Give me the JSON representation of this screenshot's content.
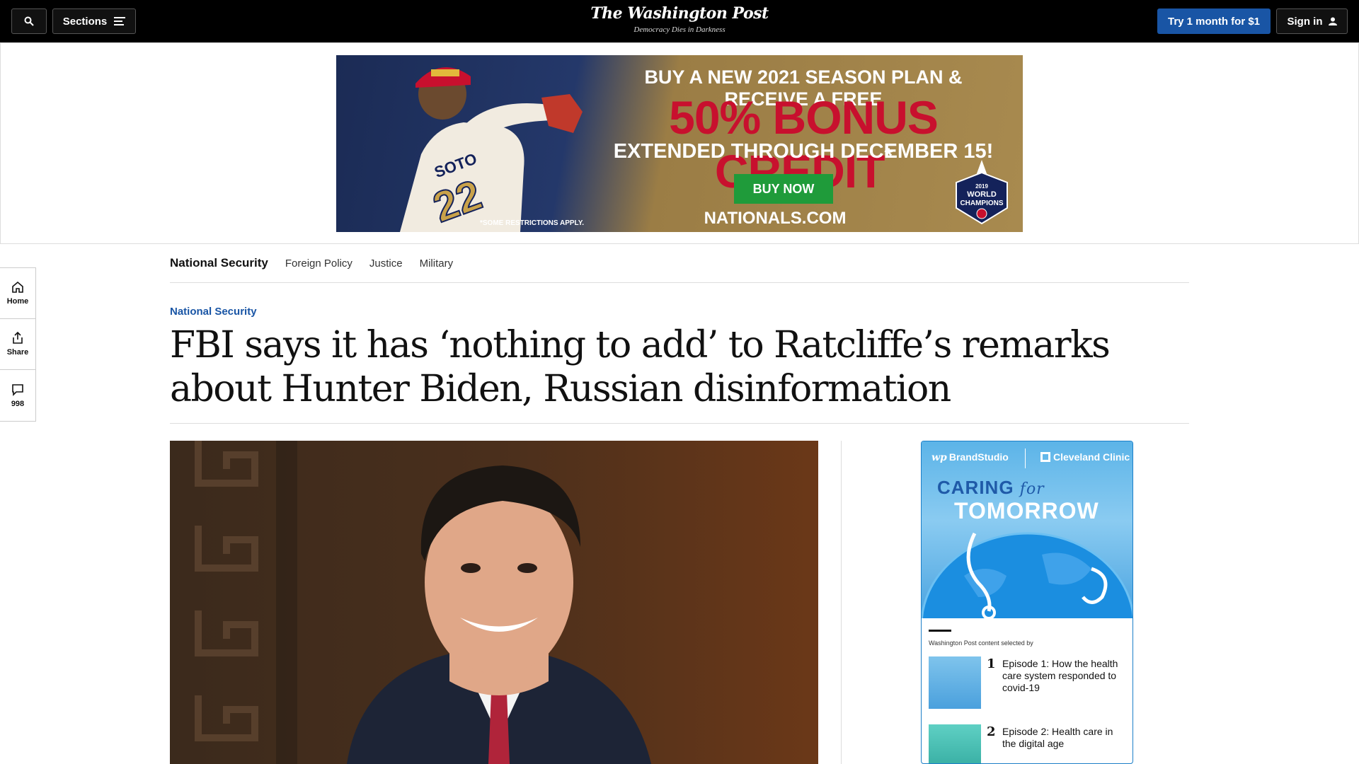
{
  "header": {
    "sections_label": "Sections",
    "logo": "The Washington Post",
    "tagline": "Democracy Dies in Darkness",
    "try_label": "Try 1 month for $1",
    "signin_label": "Sign in"
  },
  "ad": {
    "line1": "BUY A NEW 2021 SEASON PLAN & RECEIVE A FREE",
    "line2": "50% BONUS CREDIT",
    "asterisk": "*",
    "line3": "EXTENDED THROUGH DECEMBER 15!",
    "cta": "BUY NOW",
    "site": "NATIONALS.COM",
    "fine_print": "*SOME RESTRICTIONS APPLY.",
    "badge": [
      "2019",
      "WORLD",
      "CHAMPIONS"
    ],
    "jersey_name": "SOTO",
    "jersey_number": "22",
    "colors": {
      "red": "#c8102e",
      "navy": "#1b2b55",
      "gold": "#a88a4f",
      "green": "#1f9b3a"
    }
  },
  "rail": {
    "home": "Home",
    "share": "Share",
    "comments": "998"
  },
  "subnav": {
    "main": "National Security",
    "items": [
      "Foreign Policy",
      "Justice",
      "Military"
    ]
  },
  "article": {
    "kicker": "National Security",
    "headline": "FBI says it has ‘nothing to add’ to Ratcliffe’s remarks about Hunter Biden, Russian disinformation"
  },
  "sponsor": {
    "brand": "BrandStudio",
    "brand_prefix": "wp",
    "partner": "Cleveland Clinic",
    "caring": "CARING",
    "for": "for",
    "tomorrow": "TOMORROW",
    "selected_by": "Washington Post content selected by",
    "episodes": [
      {
        "num": "1",
        "title": "Episode 1: How the health care system responded to covid-19"
      },
      {
        "num": "2",
        "title": "Episode 2: Health care in the digital age"
      }
    ]
  }
}
